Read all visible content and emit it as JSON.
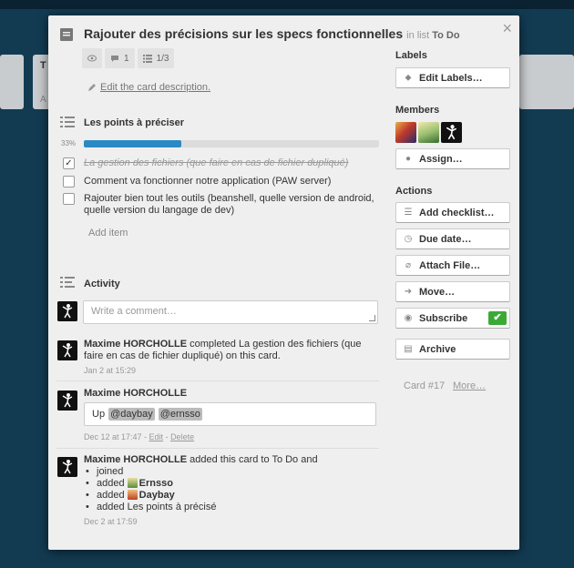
{
  "background": {
    "list_partial_title": "T",
    "list_partial_add": "A"
  },
  "card": {
    "title": "Rajouter des précisions sur les specs fonctionnelles",
    "in_list_prefix": "in list",
    "list_name": "To Do",
    "close_symbol": "×",
    "badges": {
      "comments": "1",
      "checklist": "1/3"
    },
    "description_link": "Edit the card description."
  },
  "checklist": {
    "title": "Les points à préciser",
    "percent_label": "33%",
    "progress_fraction": 0.33,
    "items": [
      {
        "text": "La gestion des fichiers (que faire en cas de fichier dupliqué)",
        "checked": true
      },
      {
        "text": "Comment va fonctionner notre application (PAW server)",
        "checked": false
      },
      {
        "text": "Rajouter bien tout les outils (beanshell, quelle version de android, quelle version du langage de dev)",
        "checked": false
      }
    ],
    "add_item_label": "Add item"
  },
  "activity": {
    "title": "Activity",
    "comment_placeholder": "Write a comment…",
    "entries": [
      {
        "author": "Maxime HORCHOLLE",
        "text": " completed La gestion des fichiers (que faire en cas de fichier dupliqué) on this card.",
        "meta": "Jan 2 at 15:29"
      },
      {
        "author": "Maxime HORCHOLLE",
        "comment_prefix": "Up",
        "mentions": [
          "@daybay",
          "@ernsso"
        ],
        "meta": "Dec 12 at 17:47 - ",
        "edit_label": "Edit",
        "separator": " - ",
        "delete_label": "Delete"
      },
      {
        "author": "Maxime HORCHOLLE",
        "text": " added this card to To Do and",
        "sub_items": {
          "joined": "joined",
          "added_word": "added",
          "ernsso": "Ernsso",
          "daybay": "Daybay",
          "checklist_text": "added Les points à précisé"
        },
        "meta": "Dec 2 at 17:59"
      }
    ]
  },
  "sidebar": {
    "labels_title": "Labels",
    "edit_labels": "Edit Labels…",
    "members_title": "Members",
    "assign": "Assign…",
    "actions_title": "Actions",
    "add_checklist": "Add checklist…",
    "due_date": "Due date…",
    "attach_file": "Attach File…",
    "move": "Move…",
    "subscribe": "Subscribe",
    "archive": "Archive",
    "card_number": "Card #17",
    "more": "More…"
  },
  "colors": {
    "progress": "#2b8ac6",
    "subscribe_check": "#3aaa35"
  }
}
